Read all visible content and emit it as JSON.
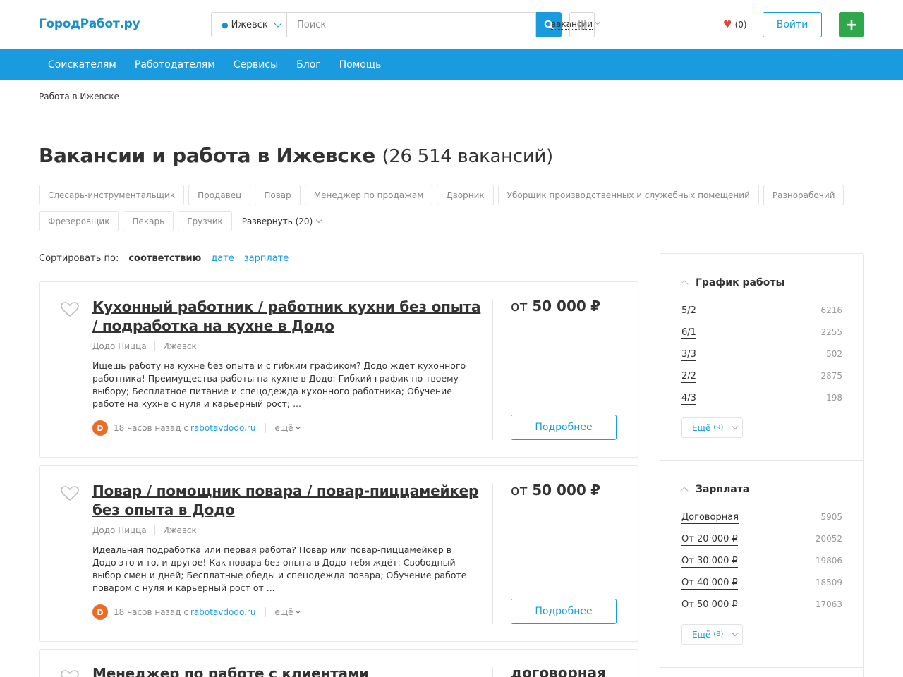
{
  "header": {
    "logo": "ГородРабот.ру",
    "city": "Ижевск",
    "search_placeholder": "Поиск",
    "search_type": "вакансии",
    "favorites_count": "(0)",
    "login_label": "Войти",
    "add_label": "+"
  },
  "nav": {
    "items": [
      "Соискателям",
      "Работодателям",
      "Сервисы",
      "Блог",
      "Помощь"
    ]
  },
  "breadcrumb": "Работа в Ижевске",
  "page": {
    "title": "Вакансии и работа в Ижевске",
    "count": "(26 514 вакансий)"
  },
  "tags": [
    "Слесарь-инструментальщик",
    "Продавец",
    "Повар",
    "Менеджер по продажам",
    "Дворник",
    "Уборщик производственных и служебных помещений",
    "Разнорабочий",
    "Фрезеровщик",
    "Пекарь",
    "Грузчик"
  ],
  "tags_expand": "Развернуть (20)",
  "sort": {
    "label": "Сортировать по:",
    "active": "соответствию",
    "option_date": "дате",
    "option_salary": "зарплате"
  },
  "vacancies": [
    {
      "title": "Кухонный работник / работник кухни без опыта / подработка на кухне в Додо",
      "company": "Додо Пицца",
      "city": "Ижевск",
      "description": "Ищешь работу на кухне без опыта и с гибким графиком? Додо ждет кухонного работника! Преимущества работы на кухне в Додо: Гибкий график по твоему выбору; Бесплатное питание и спецодежда кухонного работника; Обучение работе на кухне с нуля и карьерный рост; ...",
      "time": "18 часов назад с",
      "source": "rabotavdodo.ru",
      "more": "ещё",
      "salary_prefix": "от",
      "salary": "50 000",
      "salary_currency": "₽",
      "button": "Подробнее"
    },
    {
      "title": "Повар / помощник повара / повар-пиццамейкер без опыта в Додо",
      "company": "Додо Пицца",
      "city": "Ижевск",
      "description": "Идеальная подработка или первая работа? Повар или повар-пиццамейкер в Додо это и то, и другое! Как повара без опыта в Додо тебя ждёт: Свободный выбор смен и дней; Бесплатные обеды и спецодежда повара; Обучение работе поваром с нуля и карьерный рост от ...",
      "time": "18 часов назад с",
      "source": "rabotavdodo.ru",
      "more": "ещё",
      "salary_prefix": "от",
      "salary": "50 000",
      "salary_currency": "₽",
      "button": "Подробнее"
    },
    {
      "title": "Менеджер по работе с клиентами",
      "salary_text": "договорная"
    }
  ],
  "sidebar": {
    "schedule": {
      "title": "График работы",
      "items": [
        {
          "label": "5/2",
          "count": "6216"
        },
        {
          "label": "6/1",
          "count": "2255"
        },
        {
          "label": "3/3",
          "count": "502"
        },
        {
          "label": "2/2",
          "count": "2875"
        },
        {
          "label": "4/3",
          "count": "198"
        }
      ],
      "more_label": "Ещё",
      "more_count": "(9)"
    },
    "salary": {
      "title": "Зарплата",
      "items": [
        {
          "label": "Договорная",
          "count": "5905"
        },
        {
          "label": "От 20 000 ₽",
          "count": "20052"
        },
        {
          "label": "От 30 000 ₽",
          "count": "19806"
        },
        {
          "label": "От 40 000 ₽",
          "count": "18509"
        },
        {
          "label": "От 50 000 ₽",
          "count": "17063"
        }
      ],
      "more_label": "Ещё",
      "more_count": "(8)"
    }
  },
  "colors": {
    "brand_blue": "#1a9be0",
    "add_green": "#2ea84a",
    "heart_red": "#e0443c"
  }
}
